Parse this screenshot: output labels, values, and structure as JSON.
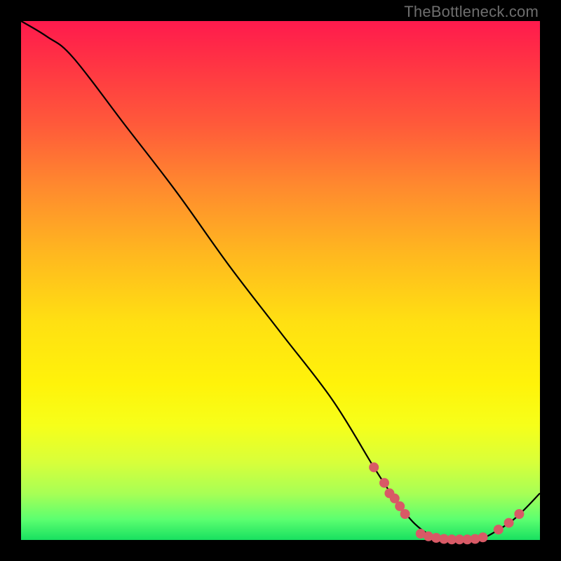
{
  "watermark": "TheBottleneck.com",
  "colors": {
    "background_frame": "#000000",
    "curve": "#000000",
    "markers": "#d85a66",
    "gradient_top": "#ff1a4d",
    "gradient_mid": "#ffe012",
    "gradient_bottom": "#18e060"
  },
  "chart_data": {
    "type": "line",
    "title": "",
    "xlabel": "",
    "ylabel": "",
    "xlim": [
      0,
      100
    ],
    "ylim": [
      0,
      100
    ],
    "grid": false,
    "series": [
      {
        "name": "curve",
        "x": [
          0,
          5,
          10,
          20,
          30,
          40,
          50,
          60,
          68,
          72,
          76,
          80,
          84,
          88,
          90,
          95,
          100
        ],
        "values": [
          100,
          97,
          93,
          80,
          67,
          53,
          40,
          27,
          14,
          8,
          3,
          0.5,
          0,
          0,
          0.8,
          4,
          9
        ]
      }
    ],
    "marker_clusters": [
      {
        "name": "left-cluster",
        "points": [
          {
            "x": 68,
            "y": 14
          },
          {
            "x": 70,
            "y": 11
          },
          {
            "x": 71,
            "y": 9
          },
          {
            "x": 72,
            "y": 8
          },
          {
            "x": 73,
            "y": 6.5
          },
          {
            "x": 74,
            "y": 5
          }
        ]
      },
      {
        "name": "valley-floor",
        "points": [
          {
            "x": 77,
            "y": 1.2
          },
          {
            "x": 78.5,
            "y": 0.7
          },
          {
            "x": 80,
            "y": 0.4
          },
          {
            "x": 81.5,
            "y": 0.2
          },
          {
            "x": 83,
            "y": 0.1
          },
          {
            "x": 84.5,
            "y": 0.1
          },
          {
            "x": 86,
            "y": 0.1
          },
          {
            "x": 87.5,
            "y": 0.2
          },
          {
            "x": 89,
            "y": 0.5
          }
        ]
      },
      {
        "name": "right-cluster",
        "points": [
          {
            "x": 92,
            "y": 2.0
          },
          {
            "x": 94,
            "y": 3.3
          },
          {
            "x": 96,
            "y": 5.0
          }
        ]
      }
    ]
  }
}
